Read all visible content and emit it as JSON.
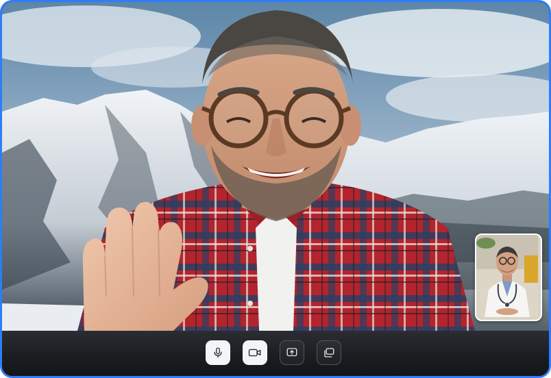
{
  "window": {
    "border_color": "#2f7df6"
  },
  "main_video": {
    "participant_role": "remote-participant",
    "background_scene": "snowy-mountains"
  },
  "pip_video": {
    "participant_role": "self-view-doctor"
  },
  "controls": [
    {
      "id": "microphone",
      "icon": "microphone-icon",
      "state": "on"
    },
    {
      "id": "camera",
      "icon": "video-camera-icon",
      "state": "on"
    },
    {
      "id": "share",
      "icon": "screen-share-icon",
      "state": "off"
    },
    {
      "id": "layout",
      "icon": "layout-switch-icon",
      "state": "off"
    }
  ],
  "colors": {
    "control_on_bg": "#f4f5f7",
    "control_off_border": "#52565e",
    "bar_bg": "#1a1c20"
  }
}
